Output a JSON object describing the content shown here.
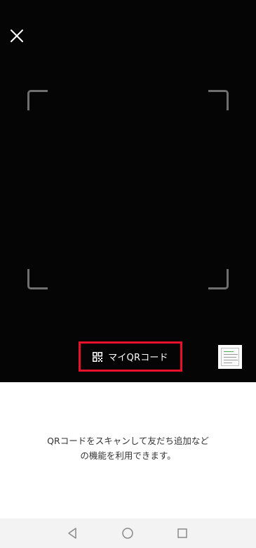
{
  "scanner": {
    "close_icon": "close-icon",
    "my_qr_label": "マイQRコード",
    "my_qr_icon": "qr-code-icon",
    "highlight_color": "#e8102a",
    "gallery_icon": "gallery-thumbnail"
  },
  "info": {
    "line1": "QRコードをスキャンして友だち追加など",
    "line2": "の機能を利用できます。"
  },
  "nav": {
    "back_icon": "back-triangle-icon",
    "home_icon": "home-circle-icon",
    "recents_icon": "recents-square-icon"
  }
}
